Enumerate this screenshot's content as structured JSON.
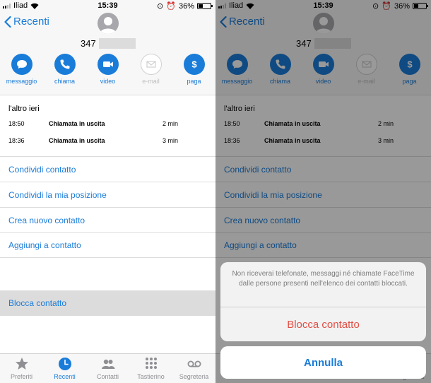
{
  "status": {
    "carrier": "Iliad",
    "time": "15:39",
    "battery": "36%"
  },
  "header": {
    "back_label": "Recenti",
    "phone_prefix": "347"
  },
  "actions": [
    {
      "label": "messaggio",
      "icon": "message-icon",
      "enabled": true
    },
    {
      "label": "chiama",
      "icon": "phone-icon",
      "enabled": true
    },
    {
      "label": "video",
      "icon": "video-icon",
      "enabled": true
    },
    {
      "label": "e-mail",
      "icon": "mail-icon",
      "enabled": false
    },
    {
      "label": "paga",
      "icon": "dollar-icon",
      "enabled": true
    }
  ],
  "recents": {
    "title": "l'altro ieri",
    "rows": [
      {
        "time": "18:50",
        "type": "Chiamata in uscita",
        "duration": "2 min"
      },
      {
        "time": "18:36",
        "type": "Chiamata in uscita",
        "duration": "3 min"
      }
    ]
  },
  "menu": [
    "Condividi contatto",
    "Condividi la mia posizione",
    "Crea nuovo contatto",
    "Aggiungi a contatto"
  ],
  "block_label": "Blocca contatto",
  "tabs": [
    {
      "label": "Preferiti",
      "icon": "star-icon",
      "active": false
    },
    {
      "label": "Recenti",
      "icon": "clock-icon",
      "active": true
    },
    {
      "label": "Contatti",
      "icon": "contacts-icon",
      "active": false
    },
    {
      "label": "Tastierino",
      "icon": "keypad-icon",
      "active": false
    },
    {
      "label": "Segreteria",
      "icon": "voicemail-icon",
      "active": false
    }
  ],
  "action_sheet": {
    "message": "Non riceverai telefonate, messaggi né chiamate FaceTime dalle persone presenti nell'elenco dei contatti bloccati.",
    "destructive_label": "Blocca contatto",
    "cancel_label": "Annulla"
  },
  "colors": {
    "accent": "#1a7cd9",
    "destructive": "#e14e44",
    "disabled": "#c0c0c0"
  }
}
